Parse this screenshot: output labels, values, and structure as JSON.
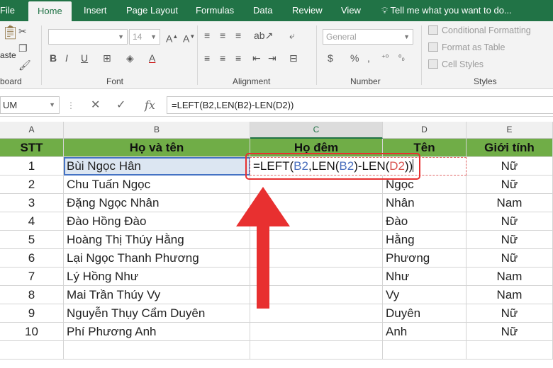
{
  "ribbon_tabs": [
    "File",
    "Home",
    "Insert",
    "Page Layout",
    "Formulas",
    "Data",
    "Review",
    "View"
  ],
  "tell_me": "Tell me what you want to do...",
  "clipboard": {
    "paste": "aste",
    "label": "board"
  },
  "font": {
    "size": "14",
    "label": "Font"
  },
  "alignment": {
    "label": "Alignment"
  },
  "number": {
    "format": "General",
    "label": "Number"
  },
  "styles": {
    "items": [
      "Conditional Formatting",
      "Format as Table",
      "Cell Styles"
    ],
    "label": "Styles"
  },
  "name_box": "UM",
  "formula_bar": "=LEFT(B2,LEN(B2)-LEN(D2))",
  "columns": [
    "A",
    "B",
    "C",
    "D",
    "E"
  ],
  "headers": [
    "STT",
    "Họ và tên",
    "Họ đêm",
    "Tên",
    "Giới tính"
  ],
  "formula_parts": [
    "=LEFT(",
    "B2",
    ",LEN(",
    "B2",
    ")-LEN(",
    "D2",
    "))"
  ],
  "rows": [
    {
      "stt": "1",
      "name": "Bùi Ngọc Hân",
      "ten": "",
      "gender": "Nữ"
    },
    {
      "stt": "2",
      "name": "Chu Tuấn Ngọc",
      "ten": "Ngọc",
      "gender": "Nữ"
    },
    {
      "stt": "3",
      "name": "Đặng Ngọc Nhân",
      "ten": "Nhân",
      "gender": "Nam"
    },
    {
      "stt": "4",
      "name": "Đào Hồng Đào",
      "ten": "Đào",
      "gender": "Nữ"
    },
    {
      "stt": "5",
      "name": "Hoàng Thị Thúy Hằng",
      "ten": "Hằng",
      "gender": "Nữ"
    },
    {
      "stt": "6",
      "name": "Lại Ngọc Thanh Phương",
      "ten": "Phương",
      "gender": "Nữ"
    },
    {
      "stt": "7",
      "name": "Lý Hồng Như",
      "ten": "Như",
      "gender": "Nam"
    },
    {
      "stt": "8",
      "name": "Mai Trần Thúy Vy",
      "ten": "Vy",
      "gender": "Nam"
    },
    {
      "stt": "9",
      "name": "Nguyễn Thụy Cẩm Duyên",
      "ten": "Duyên",
      "gender": "Nữ"
    },
    {
      "stt": "10",
      "name": "Phí Phương Anh",
      "ten": "Anh",
      "gender": "Nữ"
    }
  ],
  "colors": {
    "excel_green": "#217346",
    "header_fill": "#70ad47",
    "annotation": "#e83030",
    "ref_b": "#4a6fbd",
    "ref_d": "#d9534f"
  }
}
